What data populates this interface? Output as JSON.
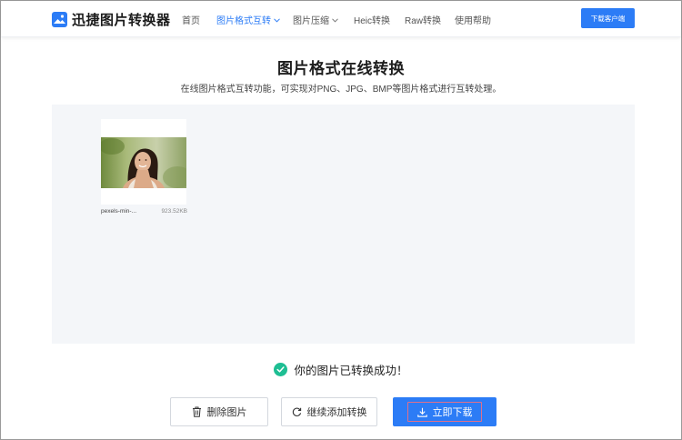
{
  "header": {
    "brand": "迅捷图片转换器",
    "nav": [
      {
        "label": "首页",
        "active": false,
        "dropdown": false
      },
      {
        "label": "图片格式互转",
        "active": true,
        "dropdown": true
      },
      {
        "label": "图片压缩",
        "active": false,
        "dropdown": true
      },
      {
        "label": "Heic转换",
        "active": false,
        "dropdown": false
      },
      {
        "label": "Raw转换",
        "active": false,
        "dropdown": false
      },
      {
        "label": "使用帮助",
        "active": false,
        "dropdown": false
      }
    ],
    "download_client": "下载客户端"
  },
  "page": {
    "title": "图片格式在线转换",
    "subtitle": "在线图片格式互转功能，可实现对PNG、JPG、BMP等图片格式进行互转处理。"
  },
  "files": [
    {
      "name": "pexels-min-...",
      "size": "923.52KB"
    }
  ],
  "status": {
    "message": "你的图片已转换成功！"
  },
  "actions": {
    "delete": "删除图片",
    "add": "继续添加转换",
    "download": "立即下载"
  },
  "colors": {
    "accent": "#2c7cf6",
    "success": "#1ebe93",
    "workspace_bg": "#f4f6f9"
  }
}
